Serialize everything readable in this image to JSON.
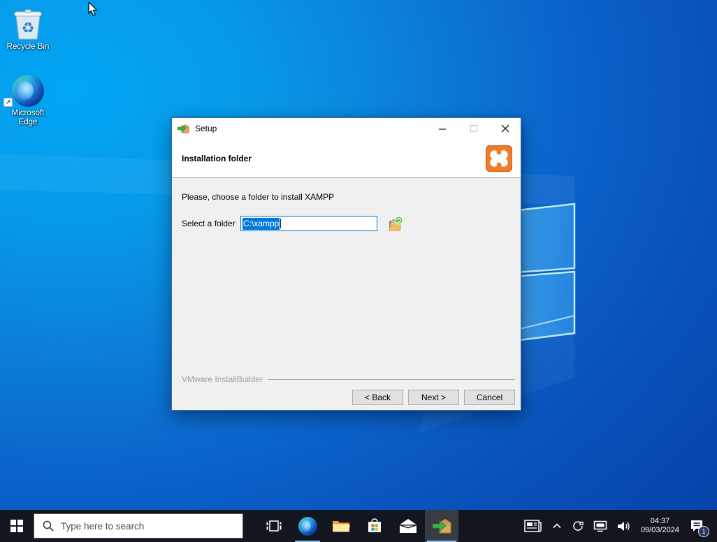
{
  "desktop": {
    "icons": [
      {
        "label": "Recycle Bin"
      },
      {
        "label": "Microsoft Edge"
      }
    ]
  },
  "window": {
    "title": "Setup",
    "header_title": "Installation folder",
    "instruction": "Please, choose a folder to install XAMPP",
    "field_label": "Select a folder",
    "field_value": "C:\\xampp",
    "brand": "VMware InstallBuilder",
    "buttons": {
      "back": "< Back",
      "next": "Next >",
      "cancel": "Cancel"
    }
  },
  "taskbar": {
    "search_placeholder": "Type here to search",
    "clock": {
      "time": "04:37",
      "date": "09/03/2024"
    },
    "notification_badge": "1"
  },
  "icons": {
    "titlebar_app": "xampp-installer-icon",
    "header_logo": "xampp-logo",
    "field_button": "browse-folder-icon",
    "taskbar": [
      "start",
      "search-magnifier",
      "task-view",
      "edge-browser",
      "file-explorer",
      "microsoft-store",
      "mail",
      "xampp-installer"
    ],
    "tray": [
      "news-widget",
      "chevron-up",
      "status-circle",
      "network",
      "volume",
      "action-center"
    ]
  },
  "colors": {
    "xampp_orange": "#f07c29",
    "selection_blue": "#0078d7",
    "window_border": "#2e6db5",
    "taskbar_bg": "#14161f",
    "underline_accent": "#76b9ed"
  }
}
